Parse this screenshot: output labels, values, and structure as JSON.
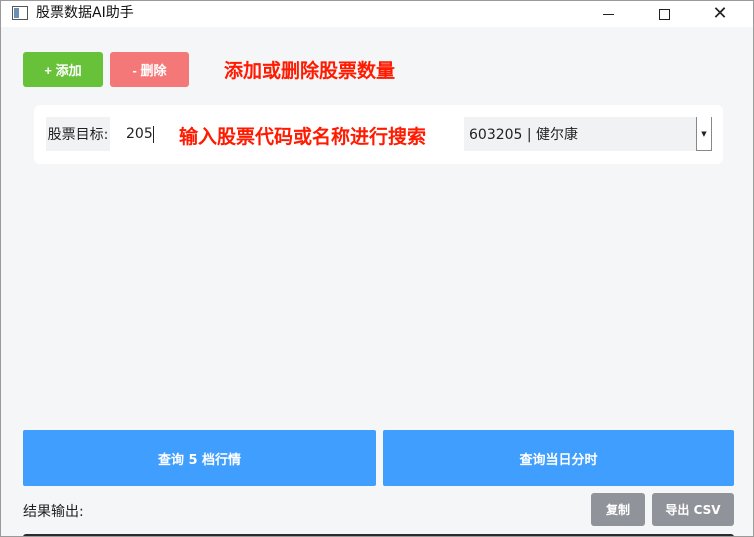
{
  "window": {
    "title": "股票数据AI助手",
    "close_glyph": "✕"
  },
  "toolbar": {
    "add_label": "+ 添加",
    "delete_label": "- 删除"
  },
  "annotations": {
    "top": "添加或删除股票数量",
    "middle": "输入股票代码或名称进行搜索"
  },
  "stock_row": {
    "label": "股票目标:",
    "input_value": "205",
    "selected_option": "603205 | 健尔康",
    "dropdown_arrow": "▼"
  },
  "actions": {
    "query_5_label": "查询 5 档行情",
    "query_day_label": "查询当日分时"
  },
  "result": {
    "label": "结果输出:",
    "copy_label": "复制",
    "export_label": "导出 CSV"
  },
  "colors": {
    "add_green": "#67c23a",
    "delete_red": "#f57878",
    "primary_blue": "#409eff",
    "neutral_gray": "#909399",
    "annotation_red": "#ff1a00"
  }
}
